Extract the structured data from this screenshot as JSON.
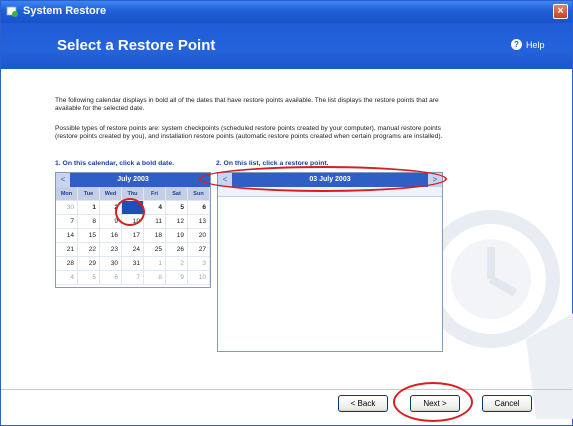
{
  "window": {
    "title": "System Restore",
    "close_glyph": "×"
  },
  "header": {
    "title": "Select a Restore Point",
    "help_label": "Help",
    "help_glyph": "?"
  },
  "intro": {
    "paragraph1": "The following calendar displays in bold all of the dates that have restore points available. The list displays the restore points that are available for the selected date.",
    "paragraph2": "Possible types of restore points are: system checkpoints (scheduled restore points created by your computer), manual restore points (restore points created by you), and installation restore points (automatic restore points created when certain programs are installed)."
  },
  "steps": {
    "step1": "1. On this calendar, click a bold date.",
    "step2": "2. On this list, click a restore point."
  },
  "calendar": {
    "month_label": "July 2003",
    "prev_glyph": "<",
    "weekdays": [
      "Mon",
      "Tue",
      "Wed",
      "Thu",
      "Fri",
      "Sat",
      "Sun"
    ],
    "weeks": [
      [
        "30",
        "1",
        "2",
        "3",
        "4",
        "5",
        "6"
      ],
      [
        "7",
        "8",
        "9",
        "10",
        "11",
        "12",
        "13"
      ],
      [
        "14",
        "15",
        "16",
        "17",
        "18",
        "19",
        "20"
      ],
      [
        "21",
        "22",
        "23",
        "24",
        "25",
        "26",
        "27"
      ],
      [
        "28",
        "29",
        "30",
        "31",
        "1",
        "2",
        "3"
      ],
      [
        "4",
        "5",
        "6",
        "7",
        "8",
        "9",
        "10"
      ]
    ],
    "selected": "3"
  },
  "restore_list": {
    "date_label": "03 July 2003",
    "prev_glyph": "<",
    "next_glyph": ">"
  },
  "buttons": {
    "back": "< Back",
    "next": "Next >",
    "cancel": "Cancel"
  },
  "colors": {
    "titlebar": "#1f5fd8",
    "header": "#2463db",
    "highlight_ellipse": "#d81e1e"
  }
}
